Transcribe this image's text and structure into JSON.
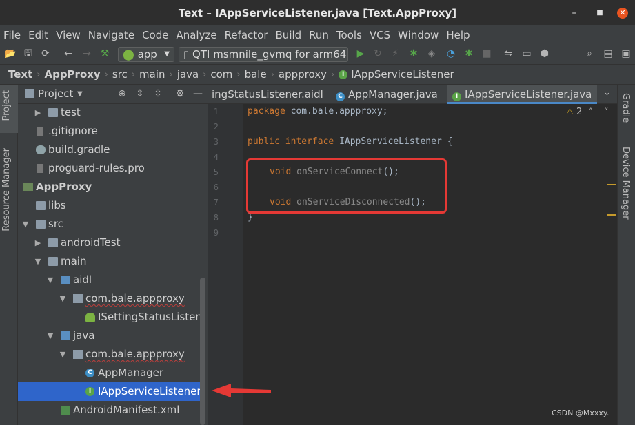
{
  "window": {
    "title": "Text – IAppServiceListener.java [Text.AppProxy]"
  },
  "menu": [
    "File",
    "Edit",
    "View",
    "Navigate",
    "Code",
    "Analyze",
    "Refactor",
    "Build",
    "Run",
    "Tools",
    "VCS",
    "Window",
    "Help"
  ],
  "toolbar": {
    "run_config": "app",
    "device": "QTI msmnile_gvmq for arm64"
  },
  "breadcrumb": [
    "Text",
    "AppProxy",
    "src",
    "main",
    "java",
    "com",
    "bale",
    "appproxy",
    "IAppServiceListener"
  ],
  "left_tabs": {
    "project": "Project",
    "resource_manager": "Resource Manager"
  },
  "right_tabs": {
    "gradle": "Gradle",
    "device_manager": "Device Manager"
  },
  "project_panel": {
    "header": "Project",
    "tree": [
      {
        "label": "test",
        "type": "folder"
      },
      {
        "label": ".gitignore",
        "type": "file"
      },
      {
        "label": "build.gradle",
        "type": "gradle"
      },
      {
        "label": "proguard-rules.pro",
        "type": "file"
      },
      {
        "label": "AppProxy",
        "type": "module"
      },
      {
        "label": "libs",
        "type": "folder"
      },
      {
        "label": "src",
        "type": "folder"
      },
      {
        "label": "androidTest",
        "type": "folder"
      },
      {
        "label": "main",
        "type": "folder"
      },
      {
        "label": "aidl",
        "type": "folder"
      },
      {
        "label": "com.bale.appproxy",
        "type": "package"
      },
      {
        "label": "ISettingStatusListener.",
        "type": "aidl"
      },
      {
        "label": "java",
        "type": "folder"
      },
      {
        "label": "com.bale.appproxy",
        "type": "package"
      },
      {
        "label": "AppManager",
        "type": "class"
      },
      {
        "label": "IAppServiceListener",
        "type": "interface"
      },
      {
        "label": "AndroidManifest.xml",
        "type": "manifest"
      }
    ]
  },
  "editor": {
    "tabs": [
      {
        "label": "ingStatusListener.aidl",
        "active": false
      },
      {
        "label": "AppManager.java",
        "active": false
      },
      {
        "label": "IAppServiceListener.java",
        "active": true
      }
    ],
    "warning_count": "2",
    "line_numbers": [
      "1",
      "2",
      "3",
      "4",
      "5",
      "6",
      "7",
      "8",
      "9"
    ],
    "code": {
      "l1_kw": "package",
      "l1_rest": " com.bale.appproxy;",
      "l3_kw1": "public",
      "l3_kw2": "interface",
      "l3_rest": " IAppServiceListener {",
      "l5_kw": "void",
      "l5_name": "onServiceConnect",
      "l5_rest": "();",
      "l7_kw": "void",
      "l7_name": "onServiceDisconnected",
      "l7_rest": "();",
      "l8": "}"
    }
  },
  "watermark": "CSDN @Mxxxy.",
  "colors": {
    "selection": "#2f65ca",
    "keyword": "#cc7832",
    "annotation_red": "#e53935"
  }
}
